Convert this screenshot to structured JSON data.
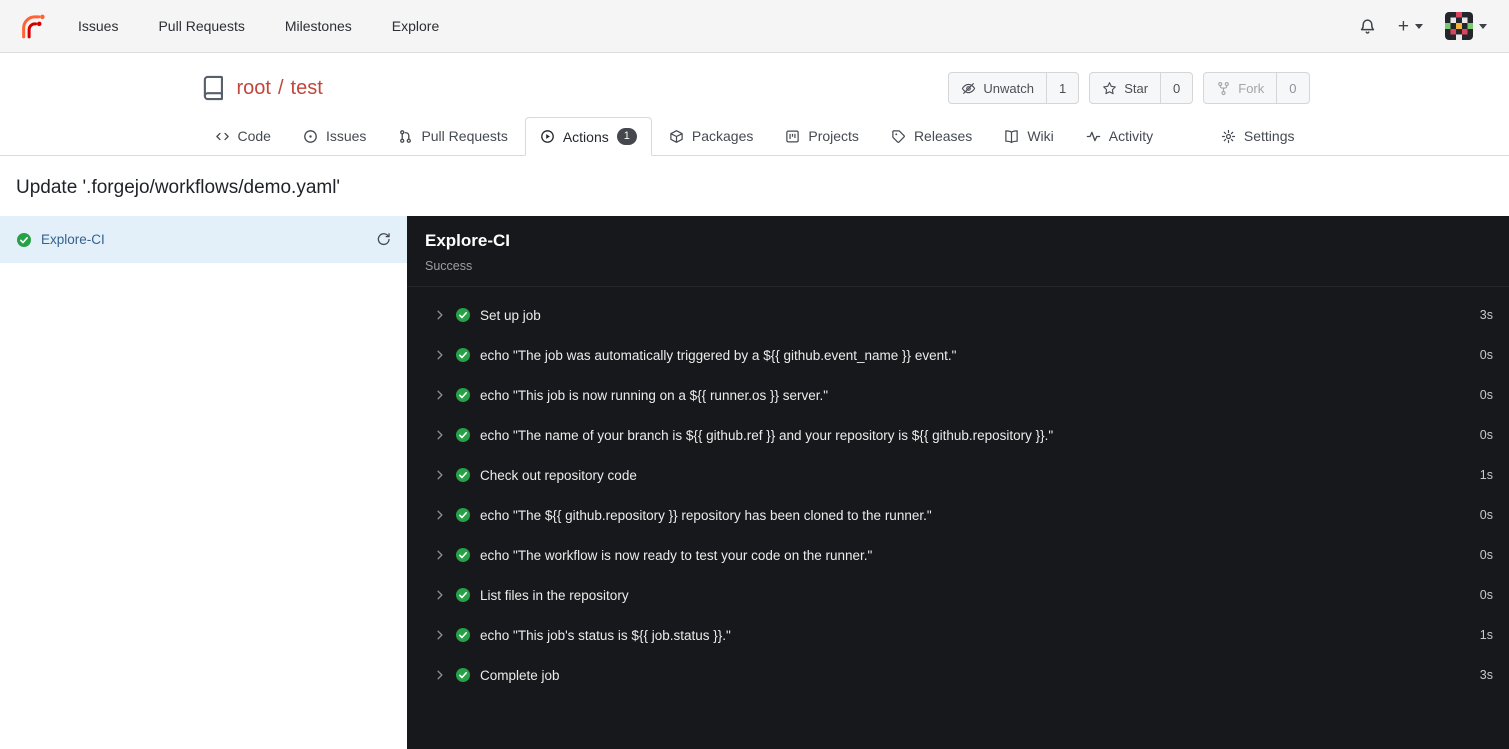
{
  "navbar": {
    "links": [
      {
        "label": "Issues"
      },
      {
        "label": "Pull Requests"
      },
      {
        "label": "Milestones"
      },
      {
        "label": "Explore"
      }
    ],
    "plus_label": "+"
  },
  "repo_header": {
    "owner": "root",
    "slash": "/",
    "name": "test",
    "buttons": [
      {
        "label": "Unwatch",
        "count": "1"
      },
      {
        "label": "Star",
        "count": "0"
      },
      {
        "label": "Fork",
        "count": "0",
        "disabled": true
      }
    ]
  },
  "tabs": {
    "items": [
      {
        "label": "Code"
      },
      {
        "label": "Issues"
      },
      {
        "label": "Pull Requests"
      },
      {
        "label": "Actions",
        "badge": "1",
        "active": true
      },
      {
        "label": "Packages"
      },
      {
        "label": "Projects"
      },
      {
        "label": "Releases"
      },
      {
        "label": "Wiki"
      },
      {
        "label": "Activity"
      }
    ],
    "settings": {
      "label": "Settings"
    }
  },
  "run_page": {
    "title": "Update '.forgejo/workflows/demo.yaml'",
    "sidebar": {
      "jobs": [
        {
          "name": "Explore-CI",
          "status": "success"
        }
      ]
    },
    "detail": {
      "name": "Explore-CI",
      "status": "Success",
      "steps": [
        {
          "name": "Set up job",
          "duration": "3s"
        },
        {
          "name": "echo \"The job was automatically triggered by a ${{ github.event_name }} event.\"",
          "duration": "0s"
        },
        {
          "name": "echo \"This job is now running on a ${{ runner.os }} server.\"",
          "duration": "0s"
        },
        {
          "name": "echo \"The name of your branch is ${{ github.ref }} and your repository is ${{ github.repository }}.\"",
          "duration": "0s"
        },
        {
          "name": "Check out repository code",
          "duration": "1s"
        },
        {
          "name": "echo \"The ${{ github.repository }} repository has been cloned to the runner.\"",
          "duration": "0s"
        },
        {
          "name": "echo \"The workflow is now ready to test your code on the runner.\"",
          "duration": "0s"
        },
        {
          "name": "List files in the repository",
          "duration": "0s"
        },
        {
          "name": "echo \"This job's status is ${{ job.status }}.\"",
          "duration": "1s"
        },
        {
          "name": "Complete job",
          "duration": "3s"
        }
      ]
    }
  },
  "colors": {
    "brand_orange": "#ff6233",
    "brand_red": "#d40000",
    "repo_name_red": "#c2463c",
    "success_green": "#26a148",
    "selected_job_bg": "#e3f0fa",
    "panel_bg": "#17181b",
    "badge_bg": "#44484e"
  }
}
